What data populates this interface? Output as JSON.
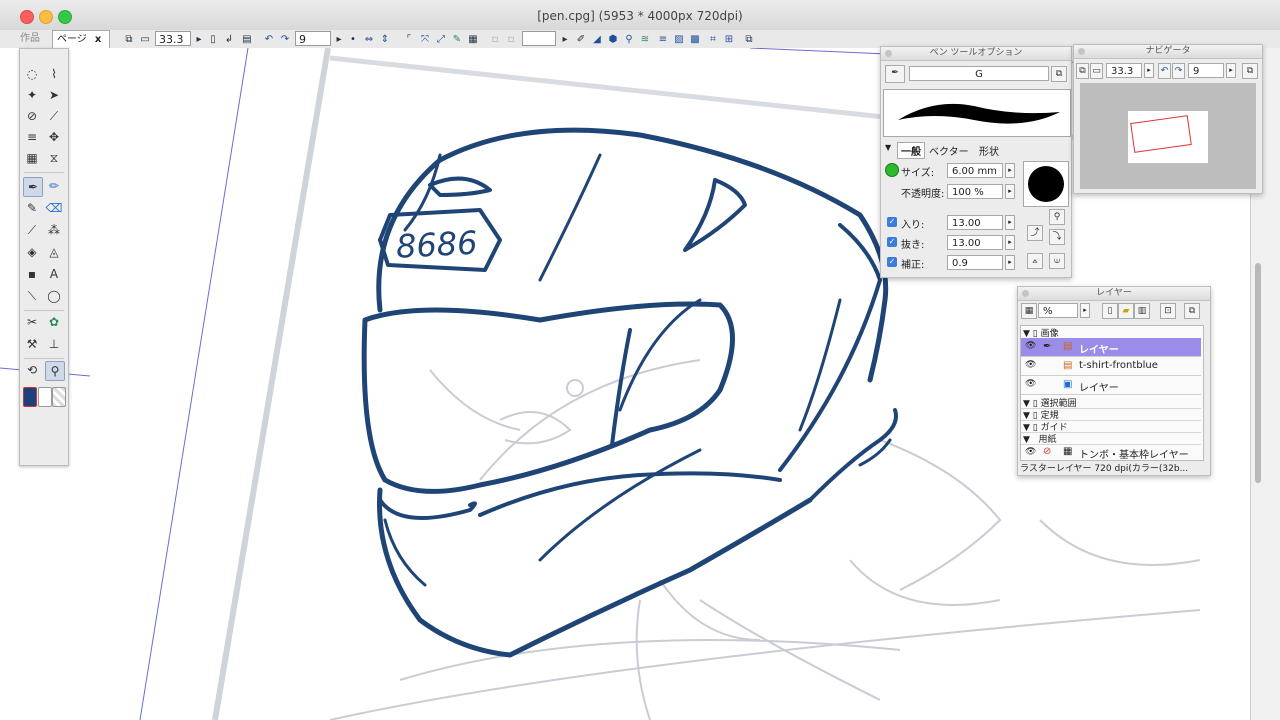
{
  "window": {
    "title": "[pen.cpg] (5953 * 4000px 720dpi)"
  },
  "toolbar": {
    "tab_work": "作品",
    "tab_page": "ページ",
    "tab_close": "x",
    "zoom": "33.3",
    "rotate": "9"
  },
  "pen_options": {
    "title": "ペン ツールオプション",
    "preset_name": "G",
    "tabs": [
      "一般",
      "ベクター",
      "形状"
    ],
    "size_label": "サイズ:",
    "size_value": "6.00 mm",
    "opacity_label": "不透明度:",
    "opacity_value": "100 %",
    "in_label": "入り:",
    "in_value": "13.00 mm",
    "out_label": "抜き:",
    "out_value": "13.00 mm",
    "correction_label": "補正:",
    "correction_value": "0.9"
  },
  "navigator": {
    "title": "ナビゲータ",
    "zoom": "33.3",
    "rotate": "9"
  },
  "layers": {
    "title": "レイヤー",
    "opacity_unit": "%",
    "group_image": "画像",
    "rows": [
      {
        "name": "レイヤー",
        "selected": true
      },
      {
        "name": "t-shirt-frontblue",
        "selected": false
      },
      {
        "name": "レイヤー",
        "selected": false
      }
    ],
    "folders": [
      "選択範囲",
      "定規",
      "ガイド",
      "用紙"
    ],
    "paper_layer": "トンボ・基本枠レイヤー",
    "status": "ラスターレイヤー 720 dpi(カラー(32b..."
  },
  "drawing": {
    "helmet_number": "8686",
    "stroke_color": "#1f4476"
  },
  "colors": {
    "selection": "#9a8ce8",
    "accent_blue": "#3b7dd8",
    "main_color": "#1f3f7a",
    "sub_color": "#ffffff"
  }
}
